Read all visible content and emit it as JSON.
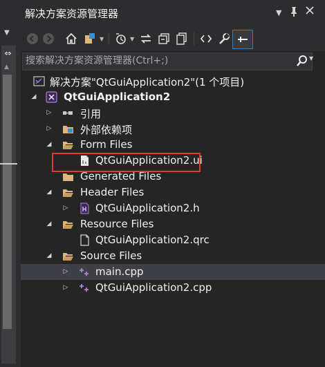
{
  "panel": {
    "title": "解决方案资源管理器",
    "dropdown_glyph": "▾",
    "pin_glyph": "📌",
    "close_glyph": "✕"
  },
  "search": {
    "placeholder": "搜索解决方案资源管理器(Ctrl+;)"
  },
  "tree": {
    "solution_label": "解决方案\"QtGuiApplication2\"(1 个项目)",
    "project_label": "QtGuiApplication2",
    "references_label": "引用",
    "external_deps_label": "外部依赖项",
    "form_files_label": "Form Files",
    "ui_file_label": "QtGuiApplication2.ui",
    "generated_files_label": "Generated Files",
    "header_files_label": "Header Files",
    "header_file_label": "QtGuiApplication2.h",
    "resource_files_label": "Resource Files",
    "qrc_file_label": "QtGuiApplication2.qrc",
    "source_files_label": "Source Files",
    "main_cpp_label": "main.cpp",
    "app_cpp_label": "QtGuiApplication2.cpp"
  },
  "icons": {
    "folder_color": "#dcb67a",
    "project_color": "#8b60c8",
    "cpp_color": "#b180d7",
    "highlight_color": "#e53935"
  }
}
